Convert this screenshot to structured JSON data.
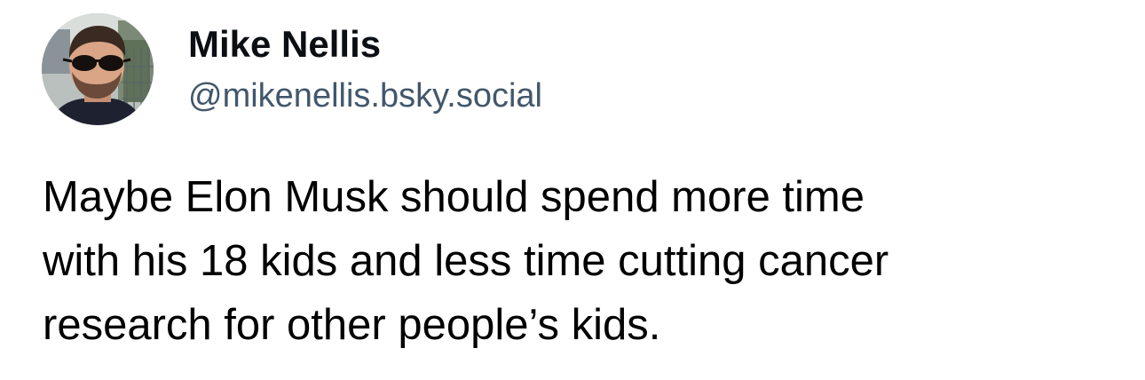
{
  "post": {
    "author": {
      "display_name": "Mike Nellis",
      "handle": "@mikenellis.bsky.social",
      "avatar_icon": "user-avatar-photo"
    },
    "text": "Maybe Elon Musk should spend more time\nwith his 18 kids and less time cutting cancer\nresearch for other people’s kids."
  },
  "colors": {
    "background": "#ffffff",
    "display_name": "#0b0f14",
    "handle": "#42576c",
    "text": "#000000"
  }
}
